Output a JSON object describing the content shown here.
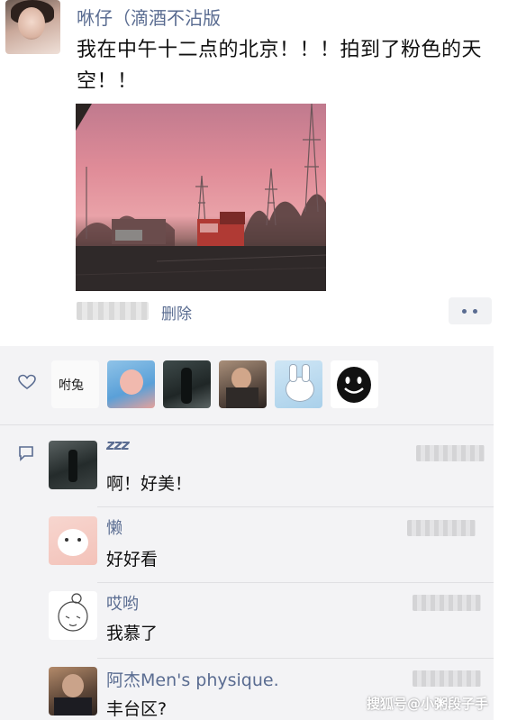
{
  "post": {
    "author": "咻仔（滴酒不沾版",
    "text": "我在中午十二点的北京！！！拍到了粉色的天空！！",
    "delete_label": "删除",
    "more_label": "••"
  },
  "likes": {
    "icon": "heart-icon",
    "avatars": [
      "avatar-calligraphy",
      "avatar-blue-girl",
      "avatar-dark-figure",
      "avatar-man-bottles",
      "avatar-bunny",
      "avatar-smiley"
    ],
    "calligraphy_text": "咐兔"
  },
  "comments": {
    "icon": "comment-icon",
    "items": [
      {
        "name": "zzz",
        "text": "啊！好美！"
      },
      {
        "name": "懒",
        "text": "好好看"
      },
      {
        "name": "哎哟",
        "text": "我慕了"
      },
      {
        "name": "阿杰Men's physique.",
        "text": "丰台区?"
      }
    ]
  },
  "watermark": "搜狐号@小粥段子手"
}
